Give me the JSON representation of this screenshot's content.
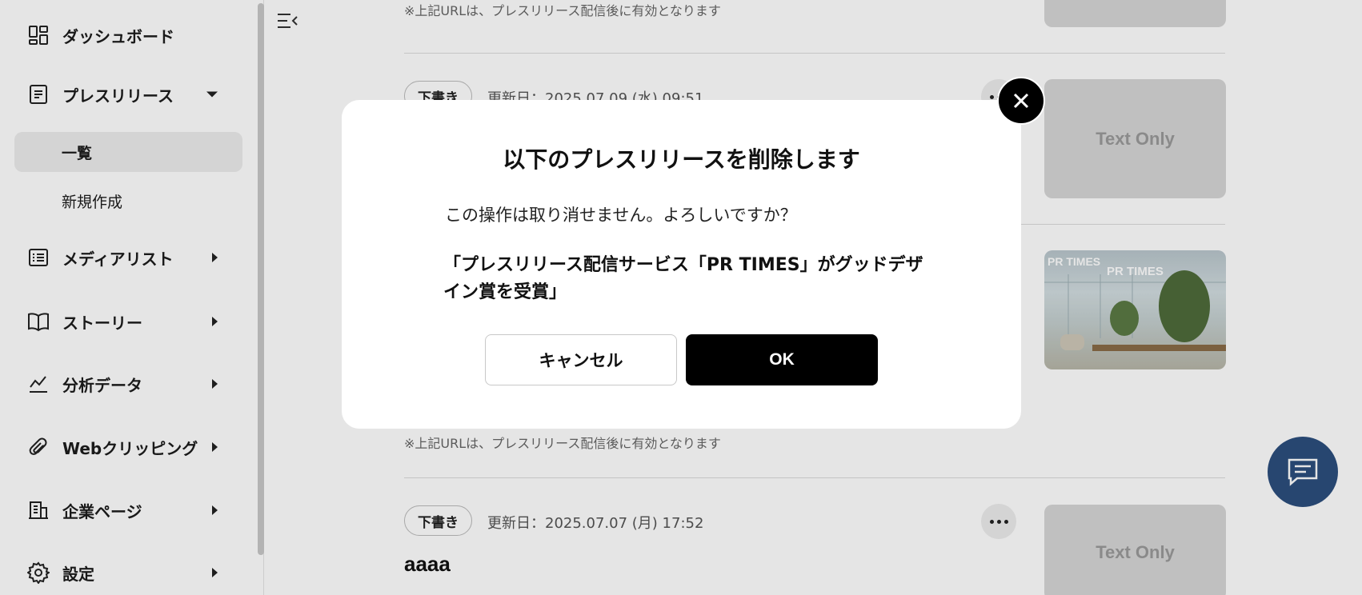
{
  "sidebar": {
    "items": [
      {
        "label": "ダッシュボード",
        "icon": "dashboard-icon"
      },
      {
        "label": "プレスリリース",
        "icon": "document-icon"
      },
      {
        "label": "メディアリスト",
        "icon": "list-icon"
      },
      {
        "label": "ストーリー",
        "icon": "book-icon"
      },
      {
        "label": "分析データ",
        "icon": "chart-line-icon"
      },
      {
        "label": "Webクリッピング",
        "icon": "paperclip-icon"
      },
      {
        "label": "企業ページ",
        "icon": "building-icon"
      },
      {
        "label": "設定",
        "icon": "gear-icon"
      }
    ],
    "press_sub": [
      {
        "label": "一覧",
        "active": true
      },
      {
        "label": "新規作成",
        "active": false
      }
    ]
  },
  "list": {
    "note_text": "※上記URLは、プレスリリース配信後に有効となります",
    "items": [
      {
        "badge": "下書き",
        "updated": "更新日：2025.07.09 (水) 09:51",
        "thumb_text": "Text Only"
      },
      {
        "thumb_logo": "PR TIMES",
        "thumb_logo2": "PR TIMES"
      },
      {
        "badge": "下書き",
        "updated": "更新日：2025.07.07 (月) 17:52",
        "title": "aaaa",
        "thumb_text": "Text Only"
      }
    ]
  },
  "modal": {
    "title": "以下のプレスリリースを削除します",
    "message": "この操作は取り消せません。よろしいですか？",
    "target": "「プレスリリース配信サービス「PR TIMES」がグッドデザイン賞を受賞」",
    "cancel_label": "キャンセル",
    "ok_label": "OK"
  },
  "colors": {
    "chat_button": "#2c4e7d",
    "ok_button": "#000000",
    "active_nav": "#ececec"
  }
}
